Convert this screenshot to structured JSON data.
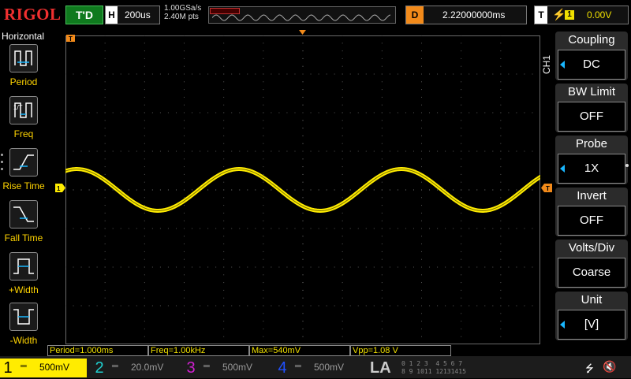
{
  "header": {
    "logo": "RIGOL",
    "run_status": "T'D",
    "timebase_label": "H",
    "timebase_value": "200us",
    "sample_rate": "1.00GSa/s",
    "memory_depth": "2.40M pts",
    "delay_label": "D",
    "delay_value": "2.22000000ms",
    "trigger_label": "T",
    "trigger_source": "1",
    "trigger_level": "0.00V"
  },
  "sidebar": {
    "title": "Horizontal",
    "items": [
      {
        "label": "Period",
        "icon": "period-icon"
      },
      {
        "label": "Freq",
        "icon": "frequency-icon"
      },
      {
        "label": "Rise Time",
        "icon": "rise-time-icon"
      },
      {
        "label": "Fall Time",
        "icon": "fall-time-icon"
      },
      {
        "label": "+Width",
        "icon": "positive-width-icon"
      },
      {
        "label": "-Width",
        "icon": "negative-width-icon"
      }
    ]
  },
  "measurements": {
    "period": "Period=1.000ms",
    "freq": "Freq=1.00kHz",
    "max": "Max=540mV",
    "vpp": "Vpp=1.08 V"
  },
  "channels": [
    {
      "num": "1",
      "scale": "500mV",
      "color": "#ffec00",
      "active": true
    },
    {
      "num": "2",
      "scale": "20.0mV",
      "color": "#20d0d0",
      "active": false
    },
    {
      "num": "3",
      "scale": "500mV",
      "color": "#d020d0",
      "active": false
    },
    {
      "num": "4",
      "scale": "500mV",
      "color": "#2050ff",
      "active": false
    }
  ],
  "la": {
    "label": "LA",
    "bits_row1": "0 1 2 3  4 5 6 7",
    "bits_row2": "8 9 1011 12131415"
  },
  "menu": {
    "channel_label": "CH1",
    "items": [
      {
        "title": "Coupling",
        "value": "DC",
        "has_arrow": true
      },
      {
        "title": "BW Limit",
        "value": "OFF",
        "has_arrow": false
      },
      {
        "title": "Probe",
        "value": "1X",
        "has_arrow": true
      },
      {
        "title": "Invert",
        "value": "OFF",
        "has_arrow": false
      },
      {
        "title": "Volts/Div",
        "value": "Coarse",
        "has_arrow": false
      },
      {
        "title": "Unit",
        "value": "[V]",
        "has_arrow": true
      }
    ]
  },
  "waveform": {
    "color": "#ffec00",
    "period_div": 4.1,
    "amplitude_div": 1.08,
    "phase_start_fraction": 0.18
  },
  "colors": {
    "accent_orange": "#f28a1a",
    "run_green": "#0f7a1e",
    "menu_arrow": "#19b7ff"
  }
}
